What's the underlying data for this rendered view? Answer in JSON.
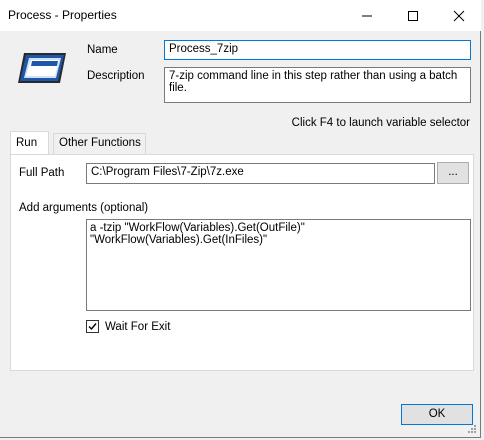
{
  "window": {
    "title": "Process - Properties"
  },
  "titlebar_icons": [
    "minimize-icon",
    "maximize-icon",
    "close-icon"
  ],
  "header": {
    "name_label": "Name",
    "name_value": "Process_7zip",
    "description_label": "Description",
    "description_value": "7-zip command line in this step rather than using a batch file.",
    "f4_hint": "Click F4 to launch variable selector"
  },
  "tabs": [
    {
      "label": "Run",
      "active": true
    },
    {
      "label": "Other Functions",
      "active": false
    }
  ],
  "run": {
    "full_path_label": "Full Path",
    "full_path_value": "C:\\Program Files\\7-Zip\\7z.exe",
    "browse_label": "...",
    "args_label": "Add arguments (optional)",
    "args_value": "a -tzip \"WorkFlow(Variables).Get(OutFile)\" \"WorkFlow(Variables).Get(InFiles)\"",
    "wait_label": "Wait For Exit",
    "wait_checked": true
  },
  "footer": {
    "ok_label": "OK"
  },
  "colors": {
    "focus_border": "#0078d7",
    "logo_blue": "#1f57a8"
  }
}
